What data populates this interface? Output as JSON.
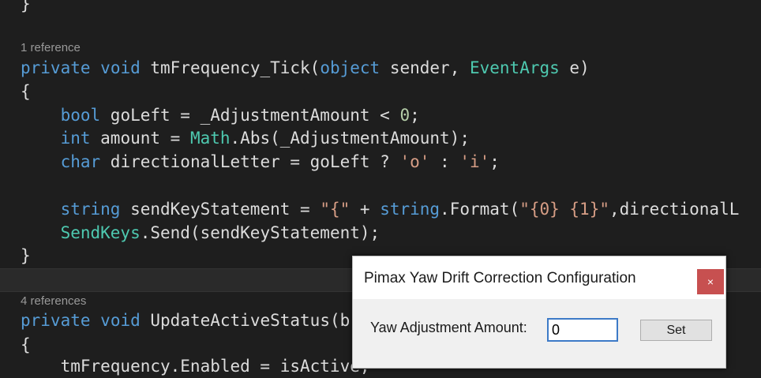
{
  "editor": {
    "lines": [
      {
        "t": [
          {
            "c": "id",
            "v": "}"
          }
        ]
      },
      {
        "t": [
          {
            "c": "kw",
            "v": "private"
          },
          {
            "c": "id",
            "v": " "
          },
          {
            "c": "kw",
            "v": "void"
          },
          {
            "c": "id",
            "v": " tmFrequency_Tick("
          },
          {
            "c": "kw",
            "v": "object"
          },
          {
            "c": "id",
            "v": " sender, "
          },
          {
            "c": "typ",
            "v": "EventArgs"
          },
          {
            "c": "id",
            "v": " e)"
          }
        ]
      },
      {
        "t": [
          {
            "c": "id",
            "v": "{"
          }
        ]
      },
      {
        "t": [
          {
            "c": "id",
            "v": "    "
          },
          {
            "c": "kw",
            "v": "bool"
          },
          {
            "c": "id",
            "v": " goLeft = _AdjustmentAmount < "
          },
          {
            "c": "num",
            "v": "0"
          },
          {
            "c": "id",
            "v": ";"
          }
        ]
      },
      {
        "t": [
          {
            "c": "id",
            "v": "    "
          },
          {
            "c": "kw",
            "v": "int"
          },
          {
            "c": "id",
            "v": " amount = "
          },
          {
            "c": "typ",
            "v": "Math"
          },
          {
            "c": "id",
            "v": ".Abs(_AdjustmentAmount);"
          }
        ]
      },
      {
        "t": [
          {
            "c": "id",
            "v": "    "
          },
          {
            "c": "kw",
            "v": "char"
          },
          {
            "c": "id",
            "v": " directionalLetter = goLeft ? "
          },
          {
            "c": "str",
            "v": "'o'"
          },
          {
            "c": "id",
            "v": " : "
          },
          {
            "c": "str",
            "v": "'i'"
          },
          {
            "c": "id",
            "v": ";"
          }
        ]
      },
      {
        "t": [
          {
            "c": "id",
            "v": "    "
          },
          {
            "c": "kw",
            "v": "string"
          },
          {
            "c": "id",
            "v": " sendKeyStatement = "
          },
          {
            "c": "str",
            "v": "\"{\""
          },
          {
            "c": "id",
            "v": " + "
          },
          {
            "c": "kw",
            "v": "string"
          },
          {
            "c": "id",
            "v": ".Format("
          },
          {
            "c": "str",
            "v": "\"{0} {1}\""
          },
          {
            "c": "id",
            "v": ",directionalL"
          }
        ]
      },
      {
        "t": [
          {
            "c": "id",
            "v": "    "
          },
          {
            "c": "typ",
            "v": "SendKeys"
          },
          {
            "c": "id",
            "v": ".Send(sendKeyStatement);"
          }
        ]
      },
      {
        "t": [
          {
            "c": "id",
            "v": "}"
          }
        ]
      },
      {
        "t": [
          {
            "c": "kw",
            "v": "private"
          },
          {
            "c": "id",
            "v": " "
          },
          {
            "c": "kw",
            "v": "void"
          },
          {
            "c": "id",
            "v": " UpdateActiveStatus(b"
          }
        ]
      },
      {
        "t": [
          {
            "c": "id",
            "v": "{"
          }
        ]
      },
      {
        "t": [
          {
            "c": "id",
            "v": "    tmFrequency.Enabled = isActive;"
          }
        ]
      }
    ],
    "code_lens": [
      "1 reference",
      "4 references"
    ]
  },
  "dialog": {
    "title": "Pimax Yaw Drift Correction Configuration",
    "close_label": "×",
    "field_label": "Yaw Adjustment Amount:",
    "amount_value": "0",
    "set_label": "Set"
  },
  "colors": {
    "editor_bg": "#1e1e1e",
    "keyword": "#569cd6",
    "type": "#4ec9b0",
    "string": "#d69d85",
    "number": "#b5cea8",
    "close_button": "#c75050"
  }
}
